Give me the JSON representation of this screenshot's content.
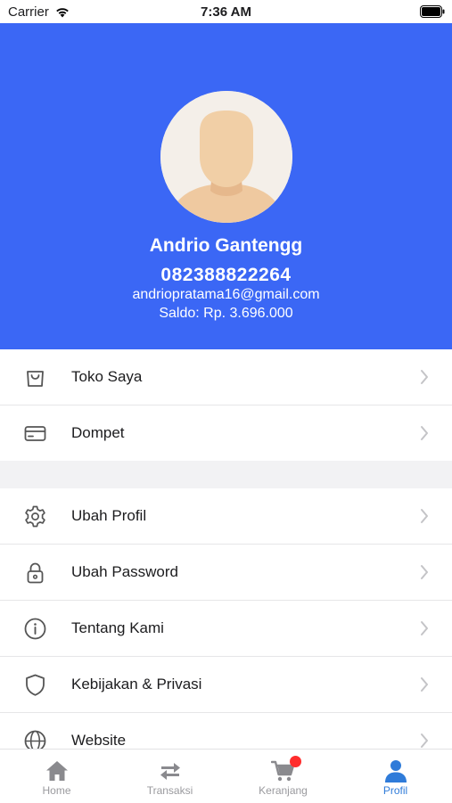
{
  "status_bar": {
    "carrier": "Carrier",
    "time": "7:36 AM"
  },
  "profile": {
    "name": "Andrio Gantengg",
    "phone": "082388822264",
    "email": "andriopratama16@gmail.com",
    "balance": "Saldo: Rp. 3.696.000"
  },
  "menu": {
    "shop": {
      "label": "Toko Saya",
      "icon": "shopping-bag-icon"
    },
    "wallet": {
      "label": "Dompet",
      "icon": "credit-card-icon"
    },
    "edit_profile": {
      "label": "Ubah Profil",
      "icon": "gear-icon"
    },
    "change_password": {
      "label": "Ubah Password",
      "icon": "lock-icon"
    },
    "about": {
      "label": "Tentang Kami",
      "icon": "info-icon"
    },
    "privacy": {
      "label": "Kebijakan & Privasi",
      "icon": "shield-icon"
    },
    "website": {
      "label": "Website",
      "icon": "globe-icon"
    }
  },
  "tab_bar": {
    "home": "Home",
    "transactions": "Transaksi",
    "cart": "Keranjang",
    "profile": "Profil",
    "active_tab": "profile"
  },
  "colors": {
    "header_blue": "#3b67f5",
    "active_tab": "#2f7bd9",
    "badge_red": "#ff2d2d"
  }
}
